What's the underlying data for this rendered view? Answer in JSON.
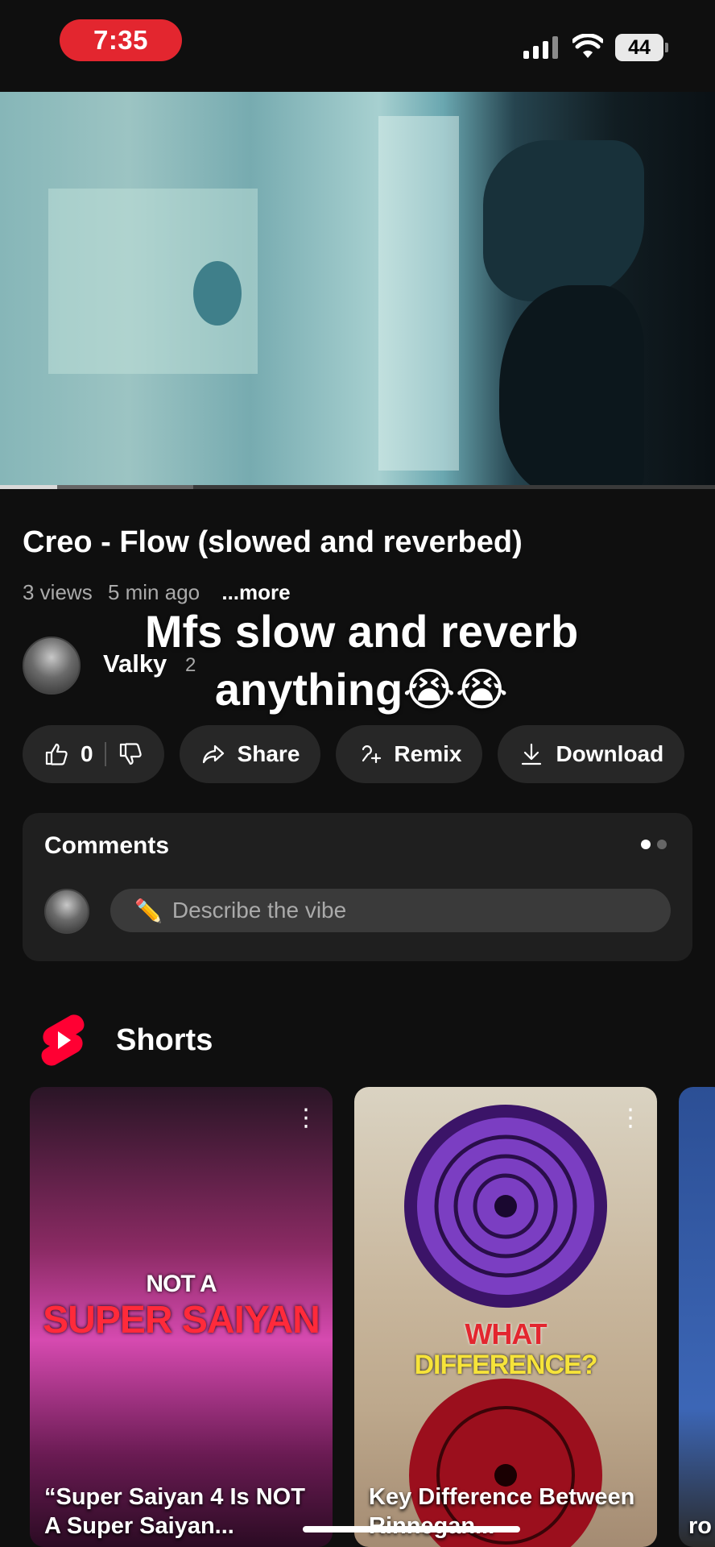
{
  "status_bar": {
    "time": "7:35",
    "battery": "44"
  },
  "player": {
    "progress": 0.08,
    "buffered": 0.27
  },
  "video": {
    "title": "Creo - Flow (slowed and reverbed)",
    "views": "3 views",
    "age": "5 min ago",
    "more": "...more",
    "channel": "Valky",
    "subscribers": "2",
    "caption": "Mfs slow and reverb anything😭😭"
  },
  "actions": {
    "likes": "0",
    "share": "Share",
    "remix": "Remix",
    "download": "Download"
  },
  "comments": {
    "title": "Comments",
    "placeholder": "Describe the vibe",
    "placeholder_icon": "✏️"
  },
  "shorts": {
    "title": "Shorts",
    "items": [
      {
        "title": "“Super Saiyan 4 Is NOT A Super Saiyan...",
        "overlay_top": "NOT A",
        "overlay_bottom": "SUPER SAIYAN"
      },
      {
        "title": "Key Difference Between Rinnegan...",
        "overlay_top": "WHAT",
        "overlay_bottom": "DIFFERENCE?"
      },
      {
        "title": "ro"
      }
    ]
  },
  "colors": {
    "accent": "#e3262f",
    "youtube_red": "#ff0033"
  }
}
